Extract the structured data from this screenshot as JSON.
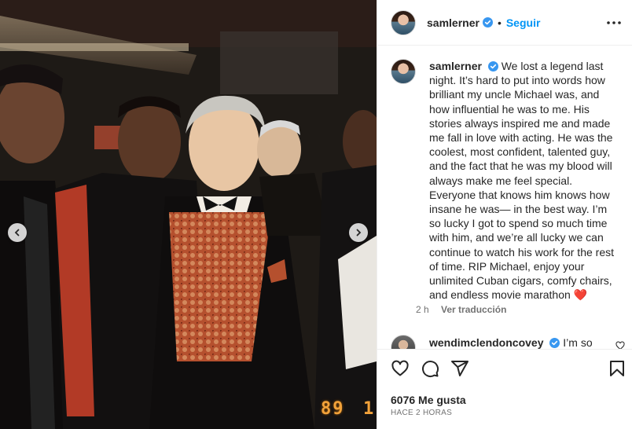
{
  "post": {
    "photo_date_stamp": "89",
    "photo_date_suffix": "1"
  },
  "header": {
    "username": "samlerner",
    "separator": "•",
    "follow_label": "Seguir"
  },
  "caption": {
    "username": "samlerner",
    "text": "We lost a legend last night. It’s hard to put into words how brilliant my uncle Michael was, and how influential he was to me. His stories always inspired me and made me fall in love with acting. He was the coolest, most confident, talented guy, and the fact that he was my blood will always make me feel special. Everyone that knows him knows how insane he was— in the best way. I’m so lucky I got to spend so much time with him, and we’re all lucky we can continue to watch his work for the rest of time. RIP Michael, enjoy your unlimited Cuban cigars, comfy chairs, and endless movie marathon",
    "emoji": "❤️",
    "time": "2 h",
    "translate_label": "Ver traducción"
  },
  "comment": {
    "username": "wendimclendoncovey",
    "text": "I’m so"
  },
  "actions": {
    "likes": "6076 Me gusta",
    "time_ago": "HACE 2 HORAS"
  },
  "colors": {
    "accent": "#0095f6",
    "verified": "#3897f0",
    "text": "#262626",
    "muted": "#737373"
  },
  "icons": {
    "more": "more-horizontal-icon",
    "like": "heart-icon",
    "comment": "comment-icon",
    "share": "share-icon",
    "save": "bookmark-icon",
    "prev": "chevron-left-icon",
    "next": "chevron-right-icon",
    "verified": "verified-badge-icon"
  }
}
